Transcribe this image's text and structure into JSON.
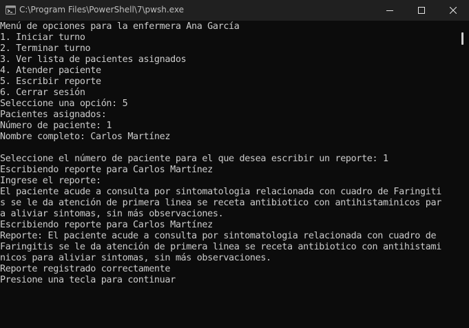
{
  "window": {
    "title": "C:\\Program Files\\PowerShell\\7\\pwsh.exe",
    "app_icon": "powershell-icon",
    "controls": {
      "minimize_icon": "minimize-icon",
      "maximize_icon": "maximize-icon",
      "close_icon": "close-icon"
    }
  },
  "colors": {
    "background": "#0c0c0c",
    "titlebar": "#202020",
    "text": "#cccccc"
  },
  "terminal": {
    "lines": [
      "Menú de opciones para la enfermera Ana García",
      "1. Iniciar turno",
      "2. Terminar turno",
      "3. Ver lista de pacientes asignados",
      "4. Atender paciente",
      "5. Escribir reporte",
      "6. Cerrar sesión",
      "Seleccione una opción: 5",
      "Pacientes asignados:",
      "Número de paciente: 1",
      "Nombre completo: Carlos Martínez",
      "",
      "Seleccione el número de paciente para el que desea escribir un reporte: 1",
      "Escribiendo reporte para Carlos Martínez",
      "Ingrese el reporte:",
      "El paciente acude a consulta por sintomatologia relacionada con cuadro de Faringiti",
      "s se le da atención de primera linea se receta antibiotico con antihistaminicos par",
      "a aliviar sintomas, sin más observaciones.",
      "Escribiendo reporte para Carlos Martínez",
      "Reporte: El paciente acude a consulta por sintomatologia relacionada con cuadro de",
      "Faringitis se le da atención de primera linea se receta antibiotico con antihistami",
      "nicos para aliviar sintomas, sin más observaciones.",
      "Reporte registrado correctamente",
      "Presione una tecla para continuar"
    ]
  }
}
